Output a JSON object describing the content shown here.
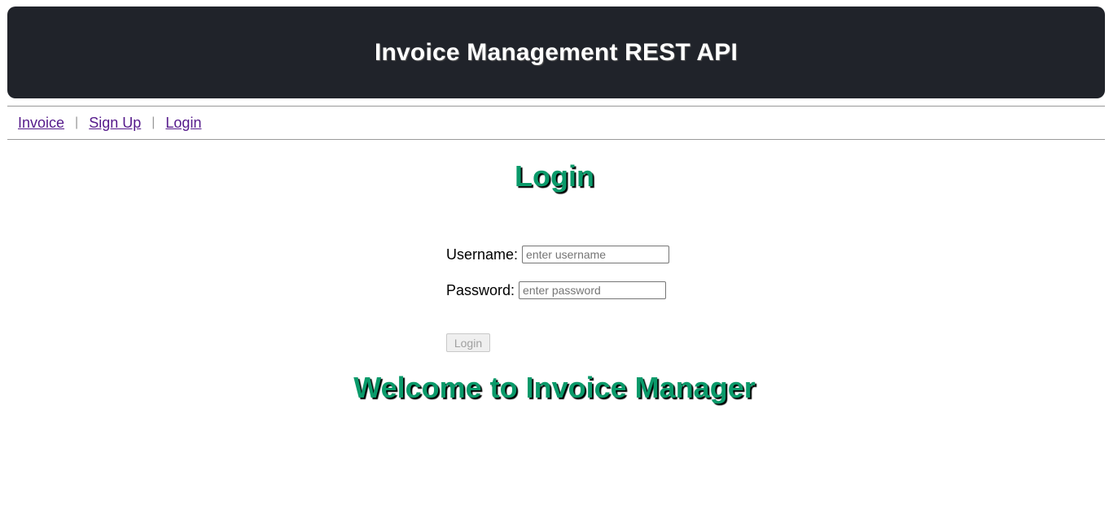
{
  "header": {
    "title": "Invoice Management REST API"
  },
  "nav": {
    "items": [
      {
        "label": "Invoice"
      },
      {
        "label": "Sign Up"
      },
      {
        "label": "Login"
      }
    ],
    "separator": "|"
  },
  "login": {
    "title": "Login",
    "username_label": "Username:",
    "username_placeholder": "enter username",
    "username_value": "",
    "password_label": "Password:",
    "password_placeholder": "enter password",
    "password_value": "",
    "submit_label": "Login"
  },
  "welcome": {
    "text": "Welcome to Invoice Manager"
  },
  "colors": {
    "header_bg": "#20232a",
    "heading_green": "#0a9a6a",
    "link_visited": "#551a8b"
  }
}
